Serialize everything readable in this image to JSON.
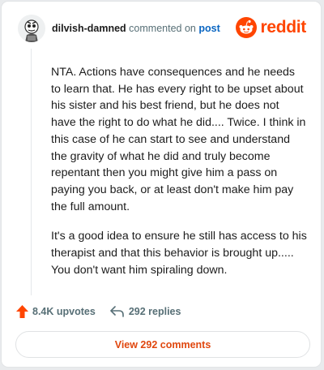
{
  "comment": {
    "author": "dilvish-damned",
    "action_text": "commented on",
    "post_link": "post",
    "paragraphs": [
      "NTA. Actions have consequences and he needs to learn that. He has every right to be upset about his sister and his best friend, but he does not have the right to do what he did.... Twice. I think in this case of he can start to see and understand the gravity of what he did and truly become repentant then you might give him a pass on paying you back, or at least don't make him pay the full amount.",
      "It's a good idea to ensure he still has access to his therapist and that this behavior is brought up..... You don't want him spiraling down."
    ]
  },
  "brand": {
    "name": "reddit",
    "icon": "reddit-logo-icon",
    "color": "#ff4500"
  },
  "footer": {
    "upvotes": "8.4K upvotes",
    "replies": "292 replies"
  },
  "view_button": "View 292 comments",
  "colors": {
    "accent": "#ff4500",
    "link": "#0a66c2",
    "muted": "#576f76"
  }
}
